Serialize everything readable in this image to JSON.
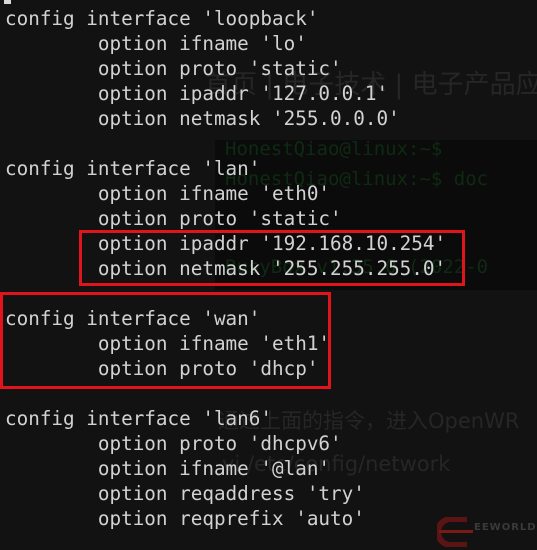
{
  "background_page": {
    "nav": "首页 | 电子技术 | 电子产品应",
    "prompt1": "HonestQiao@linux:~$",
    "prompt2": "HonestQiao@linux:~$ doc",
    "busybox": "BusyBox v1.35.0 (2022-0",
    "instruction": "通过上面的指令，进入OpenWR",
    "command": "vi /etc/config/network",
    "watermark": "EEWORLD"
  },
  "terminal": {
    "lines": [
      "config interface 'loopback'",
      "        option ifname 'lo'",
      "        option proto 'static'",
      "        option ipaddr '127.0.0.1'",
      "        option netmask '255.0.0.0'",
      "",
      "config interface 'lan'",
      "        option ifname 'eth0'",
      "        option proto 'static'",
      "        option ipaddr '192.168.10.254'",
      "        option netmask '255.255.255.0'",
      "",
      "config interface 'wan'",
      "        option ifname 'eth1'",
      "        option proto 'dhcp'",
      "",
      "config interface 'lan6'",
      "        option proto 'dhcpv6'",
      "        option ifname '@lan'",
      "        option reqaddress 'try'",
      "        option reqprefix 'auto'"
    ]
  },
  "colors": {
    "highlight": "#e0141a",
    "text": "#d2d2d2",
    "background": "#121212"
  }
}
